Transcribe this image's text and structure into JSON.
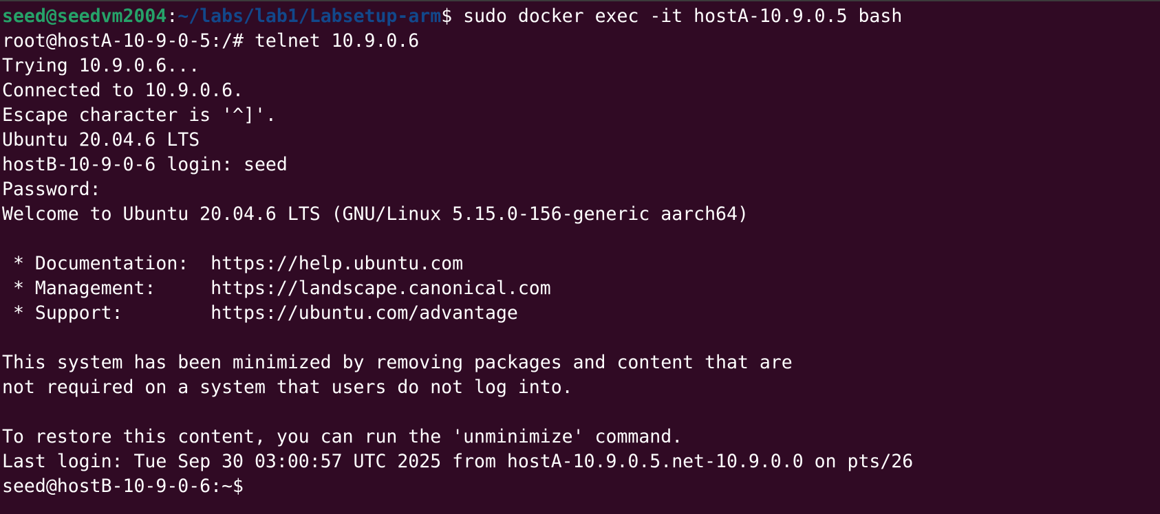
{
  "terminal": {
    "colors": {
      "background": "#300a24",
      "foreground": "#ffffff",
      "prompt_user": "#26a269",
      "prompt_path": "#12488b"
    },
    "prompt": {
      "user_host": "seed@seedvm2004",
      "separator": ":",
      "path": "~/labs/lab1/Labsetup-arm",
      "symbol": "$",
      "command": " sudo docker exec -it hostA-10.9.0.5 bash"
    },
    "lines": [
      "root@hostA-10-9-0-5:/# telnet 10.9.0.6",
      "Trying 10.9.0.6...",
      "Connected to 10.9.0.6.",
      "Escape character is '^]'.",
      "Ubuntu 20.04.6 LTS",
      "hostB-10-9-0-6 login: seed",
      "Password:",
      "Welcome to Ubuntu 20.04.6 LTS (GNU/Linux 5.15.0-156-generic aarch64)",
      "",
      " * Documentation:  https://help.ubuntu.com",
      " * Management:     https://landscape.canonical.com",
      " * Support:        https://ubuntu.com/advantage",
      "",
      "This system has been minimized by removing packages and content that are",
      "not required on a system that users do not log into.",
      "",
      "To restore this content, you can run the 'unminimize' command.",
      "Last login: Tue Sep 30 03:00:57 UTC 2025 from hostA-10.9.0.5.net-10.9.0.0 on pts/26",
      "seed@hostB-10-9-0-6:~$"
    ]
  }
}
